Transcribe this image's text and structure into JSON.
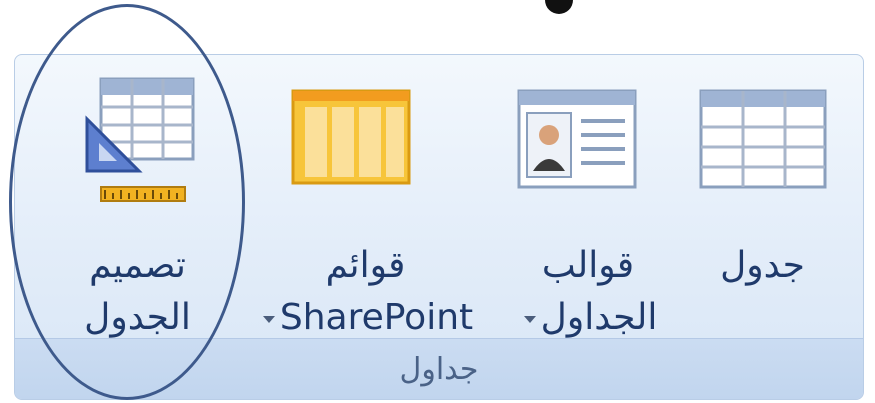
{
  "ribbon": {
    "group_label": "جداول",
    "buttons": [
      {
        "id": "table-design",
        "line1": "تصميم",
        "line2": "الجدول",
        "dropdown": false,
        "icon": "table-design-icon"
      },
      {
        "id": "sharepoint-lists",
        "line1": "قوائم",
        "line2": "SharePoint",
        "dropdown": true,
        "icon": "sharepoint-lists-icon"
      },
      {
        "id": "table-templates",
        "line1": "قوالب",
        "line2": "الجداول",
        "dropdown": true,
        "icon": "table-templates-icon"
      },
      {
        "id": "table",
        "line1": "جدول",
        "line2": "",
        "dropdown": false,
        "icon": "table-icon"
      }
    ]
  },
  "annotation": {
    "shape": "ellipse",
    "color": "#3e5a8c",
    "highlights": "table-design"
  },
  "colors": {
    "label_text": "#1f3a6b",
    "group_label_text": "#4a6287",
    "ribbon_border": "#b9cde6",
    "sharepoint_yellow": "#f7c53a"
  }
}
